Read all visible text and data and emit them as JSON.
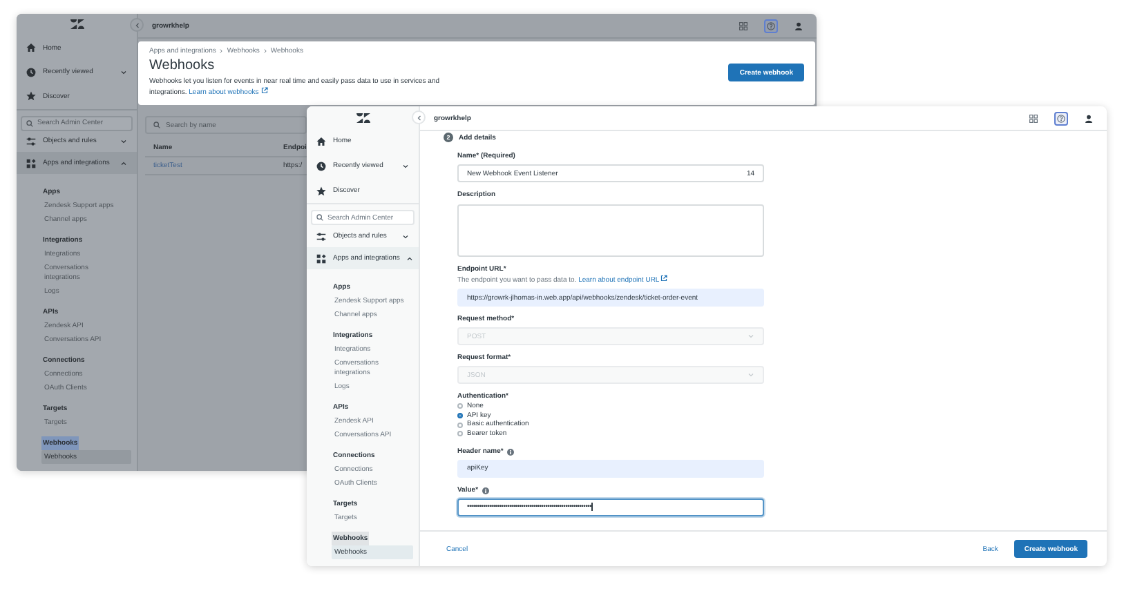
{
  "back_window": {
    "kind": "list",
    "dimmed": true,
    "workspace": "growrkhelp",
    "sidebar": {
      "items": [
        {
          "kind": "nav",
          "label": "Home",
          "selected": false
        },
        {
          "kind": "nav",
          "label": "Recently viewed",
          "expanded": false,
          "selected": false
        },
        {
          "kind": "nav",
          "label": "Discover",
          "selected": false
        },
        {
          "kind": "search",
          "placeholder": "Search Admin Center"
        },
        {
          "kind": "nav",
          "label": "Objects and rules",
          "expanded": false,
          "selected": false
        },
        {
          "kind": "nav",
          "label": "Apps and integrations",
          "expanded": true,
          "selected": true
        },
        {
          "kind": "group",
          "title": "Apps",
          "highlighted": false,
          "links": [
            {
              "label": "Zendesk Support apps",
              "selected": false
            },
            {
              "label": "Channel apps",
              "selected": false
            }
          ]
        },
        {
          "kind": "group",
          "title": "Integrations",
          "highlighted": false,
          "links": [
            {
              "label": "Integrations",
              "selected": false
            },
            {
              "label": "Conversations integrations",
              "selected": false
            },
            {
              "label": "Logs",
              "selected": false
            }
          ]
        },
        {
          "kind": "group",
          "title": "APIs",
          "highlighted": false,
          "links": [
            {
              "label": "Zendesk API",
              "selected": false
            },
            {
              "label": "Conversations API",
              "selected": false
            }
          ]
        },
        {
          "kind": "group",
          "title": "Connections",
          "highlighted": false,
          "links": [
            {
              "label": "Connections",
              "selected": false
            },
            {
              "label": "OAuth Clients",
              "selected": false
            }
          ]
        },
        {
          "kind": "group",
          "title": "Targets",
          "highlighted": false,
          "links": [
            {
              "label": "Targets",
              "selected": false
            }
          ]
        },
        {
          "kind": "group",
          "title": "Webhooks",
          "highlighted": true,
          "links": [
            {
              "label": "Webhooks",
              "selected": true
            }
          ]
        }
      ]
    },
    "topbar_icons": [
      {
        "kind": "grid",
        "active": false
      },
      {
        "kind": "help",
        "active": true
      },
      {
        "kind": "user",
        "active": false
      }
    ],
    "header": {
      "breadcrumb": [
        "Apps and integrations",
        "Webhooks",
        "Webhooks"
      ],
      "title": "Webhooks",
      "description": "Webhooks let you listen for events in near real time and easily pass data to use in services and integrations.",
      "link": "Learn about webhooks",
      "button": "Create webhook"
    },
    "search": {
      "placeholder": "Search by name"
    },
    "table": {
      "columns": [
        "Name",
        "Endpoi"
      ],
      "rows": [
        [
          "ticketTest",
          "https:/"
        ]
      ]
    }
  },
  "front_window": {
    "kind": "form",
    "dimmed": false,
    "workspace": "growrkhelp",
    "sidebar": {
      "items": [
        {
          "kind": "nav",
          "label": "Home",
          "selected": false
        },
        {
          "kind": "nav",
          "label": "Recently viewed",
          "expanded": false,
          "selected": false
        },
        {
          "kind": "nav",
          "label": "Discover",
          "selected": false
        },
        {
          "kind": "search",
          "placeholder": "Search Admin Center"
        },
        {
          "kind": "nav",
          "label": "Objects and rules",
          "expanded": false,
          "selected": false
        },
        {
          "kind": "nav",
          "label": "Apps and integrations",
          "expanded": true,
          "selected": true
        },
        {
          "kind": "group",
          "title": "Apps",
          "highlighted": false,
          "links": [
            {
              "label": "Zendesk Support apps",
              "selected": false
            },
            {
              "label": "Channel apps",
              "selected": false
            }
          ]
        },
        {
          "kind": "group",
          "title": "Integrations",
          "highlighted": false,
          "links": [
            {
              "label": "Integrations",
              "selected": false
            },
            {
              "label": "Conversations integrations",
              "selected": false
            },
            {
              "label": "Logs",
              "selected": false
            }
          ]
        },
        {
          "kind": "group",
          "title": "APIs",
          "highlighted": false,
          "links": [
            {
              "label": "Zendesk API",
              "selected": false
            },
            {
              "label": "Conversations API",
              "selected": false
            }
          ]
        },
        {
          "kind": "group",
          "title": "Connections",
          "highlighted": false,
          "links": [
            {
              "label": "Connections",
              "selected": false
            },
            {
              "label": "OAuth Clients",
              "selected": false
            }
          ]
        },
        {
          "kind": "group",
          "title": "Targets",
          "highlighted": false,
          "links": [
            {
              "label": "Targets",
              "selected": false
            }
          ]
        },
        {
          "kind": "group",
          "title": "Webhooks",
          "highlighted": true,
          "links": [
            {
              "label": "Webhooks",
              "selected": true
            }
          ]
        }
      ]
    },
    "topbar_icons": [
      {
        "kind": "grid",
        "active": false
      },
      {
        "kind": "help",
        "active": true
      },
      {
        "kind": "user",
        "active": false
      }
    ],
    "step": {
      "number": "2",
      "title": "Add details"
    },
    "fields": [
      {
        "kind": "text",
        "label": "Name* (Required)",
        "value": "New Webhook Event Listener",
        "counter": "14",
        "autofilled": false,
        "focused": false
      },
      {
        "kind": "textarea",
        "label": "Description"
      },
      {
        "kind": "text",
        "label": "Endpoint URL*",
        "hint": "The endpoint you want to pass data to.",
        "hint_link": "Learn about endpoint URL",
        "value": "https://growrk-jlhomas-in.web.app/api/webhooks/zendesk/ticket-order-event",
        "autofilled": true,
        "focused": false
      },
      {
        "kind": "select",
        "label": "Request method*",
        "value": "POST",
        "disabled": true
      },
      {
        "kind": "select",
        "label": "Request format*",
        "value": "JSON",
        "disabled": true
      },
      {
        "kind": "radio",
        "label": "Authentication*",
        "options": [
          {
            "label": "None",
            "selected": false
          },
          {
            "label": "API key",
            "selected": true
          },
          {
            "label": "Basic authentication",
            "selected": false
          },
          {
            "label": "Bearer token",
            "selected": false
          }
        ]
      },
      {
        "kind": "text",
        "label": "Header name*",
        "info": true,
        "value": "apiKey",
        "autofilled": true,
        "focused": false
      },
      {
        "kind": "text",
        "label": "Value*",
        "info": true,
        "value": "••••••••••••••••••••••••••••••••••••••••••••••••••••••••••••••",
        "autofilled": false,
        "focused": true
      }
    ],
    "footer": {
      "cancel": "Cancel",
      "back": "Back",
      "submit": "Create webhook"
    }
  }
}
